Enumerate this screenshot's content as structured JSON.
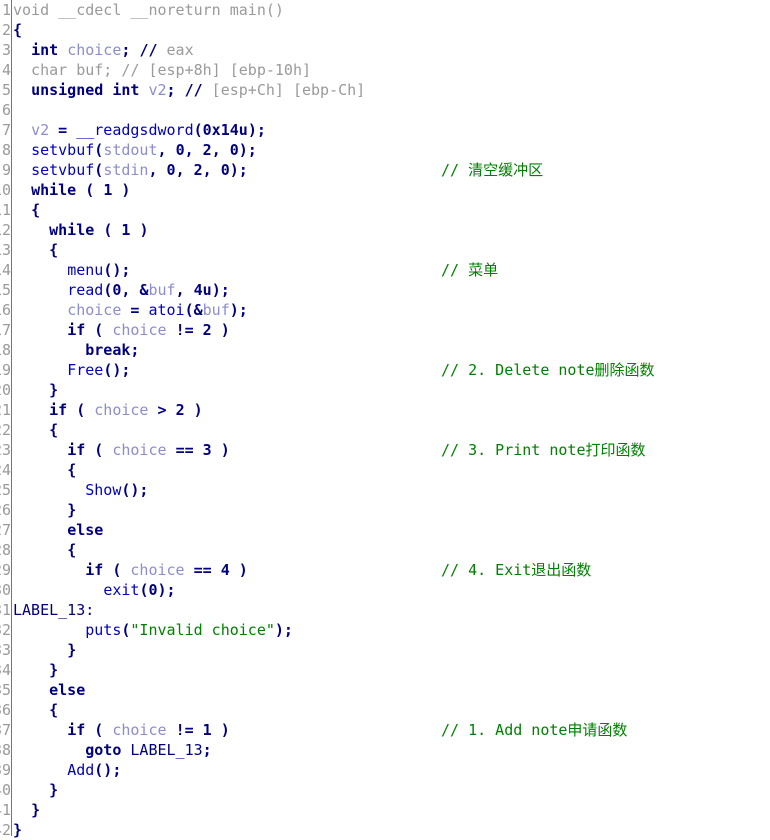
{
  "view": {
    "title": "IDA Pro Pseudocode",
    "background": "#ffffff",
    "gutter_separator_color": "#4a7ebb",
    "colors": {
      "keyword": "#00007f",
      "function": "#0000c0",
      "variable": "#8c8cd0",
      "gray": "#9a9a9a",
      "string": "#008000",
      "comment": "#008000",
      "lineno": "#9a9a9a"
    }
  },
  "lines": [
    {
      "n": "1",
      "text": "void __cdecl __noreturn main()",
      "comment": ""
    },
    {
      "n": "2",
      "text": "{",
      "comment": ""
    },
    {
      "n": "3",
      "text": "  int choice; // eax",
      "comment": ""
    },
    {
      "n": "4",
      "text": "  char buf; // [esp+8h] [ebp-10h]",
      "comment": ""
    },
    {
      "n": "5",
      "text": "  unsigned int v2; // [esp+Ch] [ebp-Ch]",
      "comment": ""
    },
    {
      "n": "6",
      "text": "",
      "comment": ""
    },
    {
      "n": "7",
      "text": "  v2 = __readgsdword(0x14u);",
      "comment": ""
    },
    {
      "n": "8",
      "text": "  setvbuf(stdout, 0, 2, 0);",
      "comment": ""
    },
    {
      "n": "9",
      "text": "  setvbuf(stdin, 0, 2, 0);",
      "comment": "// 清空缓冲区"
    },
    {
      "n": "10",
      "text": "  while ( 1 )",
      "comment": ""
    },
    {
      "n": "11",
      "text": "  {",
      "comment": ""
    },
    {
      "n": "12",
      "text": "    while ( 1 )",
      "comment": ""
    },
    {
      "n": "13",
      "text": "    {",
      "comment": ""
    },
    {
      "n": "14",
      "text": "      menu();",
      "comment": "// 菜单"
    },
    {
      "n": "15",
      "text": "      read(0, &buf, 4u);",
      "comment": ""
    },
    {
      "n": "16",
      "text": "      choice = atoi(&buf);",
      "comment": ""
    },
    {
      "n": "17",
      "text": "      if ( choice != 2 )",
      "comment": ""
    },
    {
      "n": "18",
      "text": "        break;",
      "comment": ""
    },
    {
      "n": "19",
      "text": "      Free();",
      "comment": "// 2. Delete note删除函数"
    },
    {
      "n": "20",
      "text": "    }",
      "comment": ""
    },
    {
      "n": "21",
      "text": "    if ( choice > 2 )",
      "comment": ""
    },
    {
      "n": "22",
      "text": "    {",
      "comment": ""
    },
    {
      "n": "23",
      "text": "      if ( choice == 3 )",
      "comment": "// 3. Print note打印函数"
    },
    {
      "n": "24",
      "text": "      {",
      "comment": ""
    },
    {
      "n": "25",
      "text": "        Show();",
      "comment": ""
    },
    {
      "n": "26",
      "text": "      }",
      "comment": ""
    },
    {
      "n": "27",
      "text": "      else",
      "comment": ""
    },
    {
      "n": "28",
      "text": "      {",
      "comment": ""
    },
    {
      "n": "29",
      "text": "        if ( choice == 4 )",
      "comment": "// 4. Exit退出函数"
    },
    {
      "n": "30",
      "text": "          exit(0);",
      "comment": ""
    },
    {
      "n": "31",
      "text": "LABEL_13:",
      "comment": ""
    },
    {
      "n": "32",
      "text": "        puts(\"Invalid choice\");",
      "comment": ""
    },
    {
      "n": "33",
      "text": "      }",
      "comment": ""
    },
    {
      "n": "34",
      "text": "    }",
      "comment": ""
    },
    {
      "n": "35",
      "text": "    else",
      "comment": ""
    },
    {
      "n": "36",
      "text": "    {",
      "comment": ""
    },
    {
      "n": "37",
      "text": "      if ( choice != 1 )",
      "comment": "// 1. Add note申请函数"
    },
    {
      "n": "38",
      "text": "        goto LABEL_13;",
      "comment": ""
    },
    {
      "n": "39",
      "text": "      Add();",
      "comment": ""
    },
    {
      "n": "40",
      "text": "    }",
      "comment": ""
    },
    {
      "n": "41",
      "text": "  }",
      "comment": ""
    },
    {
      "n": "42",
      "text": "}",
      "comment": ""
    }
  ],
  "token_rules": {
    "keywords": [
      "void",
      "int",
      "char",
      "unsigned",
      "while",
      "if",
      "else",
      "break",
      "goto",
      "return"
    ],
    "functions": [
      "main",
      "__readgsdword",
      "setvbuf",
      "menu",
      "read",
      "atoi",
      "Free",
      "Show",
      "exit",
      "puts",
      "Add"
    ],
    "variables": [
      "choice",
      "buf",
      "v2",
      "stdout",
      "stdin"
    ],
    "gray_lines": [
      1,
      4
    ],
    "gray_trailing_comment_lines": [
      3,
      5
    ]
  }
}
